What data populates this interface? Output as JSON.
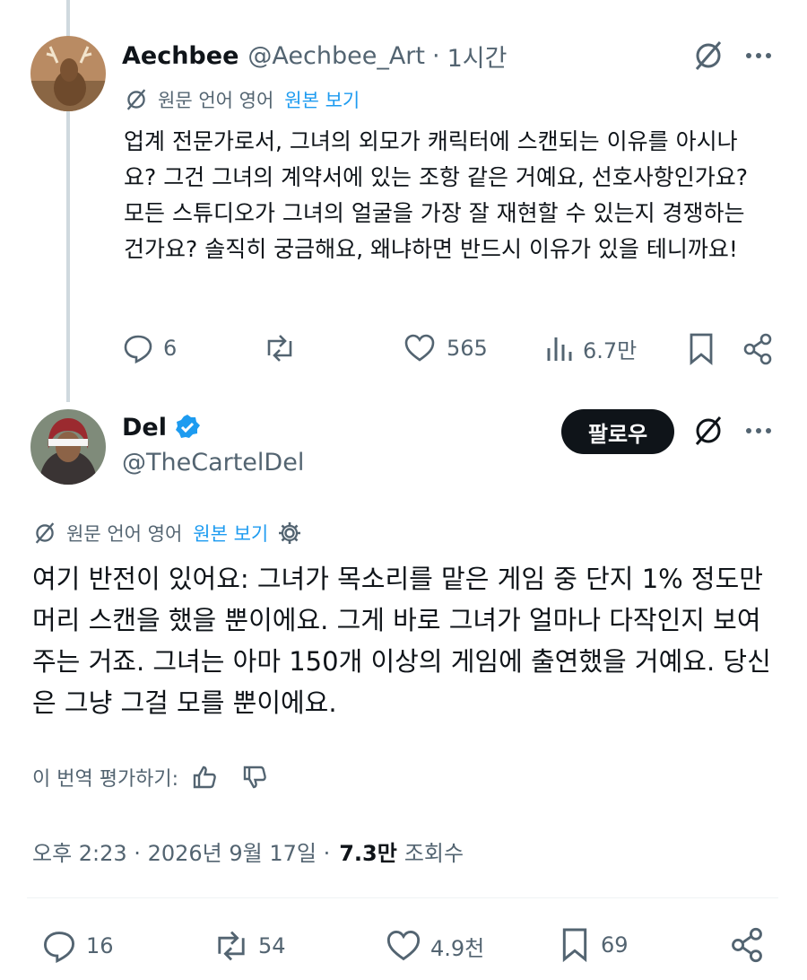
{
  "reply": {
    "name": "Aechbee",
    "handle": "@Aechbee_Art",
    "separator": "·",
    "time": "1시간",
    "translation_label": "원문 언어 영어",
    "show_original": "원본 보기",
    "text": "업계 전문가로서, 그녀의 외모가 캐릭터에 스캔되는 이유를 아시나요? 그건 그녀의 계약서에 있는 조항 같은 거예요, 선호사항인가요? 모든 스튜디오가 그녀의 얼굴을 가장 잘 재현할 수 있는지 경쟁하는 건가요? 솔직히 궁금해요, 왜냐하면 반드시 이유가 있을 테니까요!",
    "stats": {
      "replies": "6",
      "likes": "565",
      "views": "6.7만"
    }
  },
  "main": {
    "name": "Del",
    "handle": "@TheCartelDel",
    "follow_label": "팔로우",
    "translation_label": "원문 언어 영어",
    "show_original": "원본 보기",
    "text": "여기 반전이 있어요: 그녀가 목소리를 맡은 게임 중 단지 1% 정도만 머리 스캔을 했을 뿐이에요. 그게 바로 그녀가 얼마나 다작인지 보여주는 거죠. 그녀는 아마 150개 이상의 게임에 출연했을 거예요. 당신은 그냥 그걸 모를 뿐이에요.",
    "rate_translation": "이 번역 평가하기:",
    "timestamp": "오후 2:23 · 2026년 9월 17일 ·",
    "views_count": "7.3만",
    "views_label": "조회수",
    "stats": {
      "replies": "16",
      "reposts": "54",
      "likes": "4.9천",
      "bookmarks": "69"
    }
  },
  "colors": {
    "text": "#0f1419",
    "muted": "#536471",
    "link": "#1d9bf0",
    "verified": "#1d9bf0",
    "divider": "#eff3f4"
  }
}
